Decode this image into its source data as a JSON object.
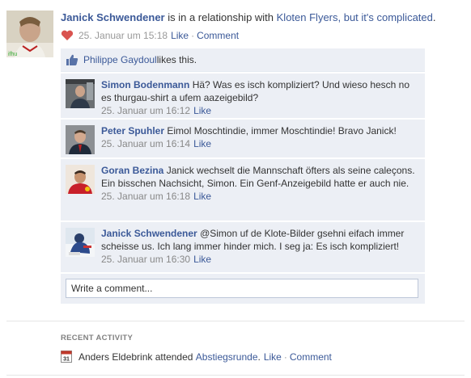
{
  "story": {
    "actor": "Janick Schwendener",
    "text_middle": " is in a relationship with ",
    "target": "Kloten Flyers, but it's complicated",
    "text_end": ".",
    "timestamp": "25. Januar um 15:18",
    "like_label": "Like",
    "comment_label": "Comment"
  },
  "likes": {
    "liker": "Philippe Gaydoul",
    "suffix": " likes this."
  },
  "comments": [
    {
      "author": "Simon Bodenmann",
      "text": "Hä? Was es isch kompliziert? Und wieso hesch no es thurgau-shirt a ufem aazeigebild?",
      "timestamp": "25. Januar um 16:12",
      "like_label": "Like"
    },
    {
      "author": "Peter Spuhler",
      "text": "Eimol Moschtindie, immer Moschtindie! Bravo Janick!",
      "timestamp": "25. Januar um 16:14",
      "like_label": "Like"
    },
    {
      "author": "Goran Bezina",
      "text": "Janick wechselt die Mannschaft öfters als seine caleçons. Ein bisschen Nachsicht, Simon. Ein Genf-Anzeigebild hatte er auch nie.",
      "timestamp": "25. Januar um 16:18",
      "like_label": "Like"
    },
    {
      "author": "Janick Schwendener",
      "text": "@Simon uf de Klote-Bilder gsehni eifach immer scheisse us. Ich lang immer hinder mich. I seg ja: Es isch kompliziert!",
      "timestamp": "25. Januar um 16:30",
      "like_label": "Like"
    }
  ],
  "write_comment": {
    "placeholder": "Write a comment..."
  },
  "recent_activity": {
    "title": "RECENT ACTIVITY",
    "calendar_day": "31",
    "actor": "Anders Eldebrink",
    "verb": " attended ",
    "event": "Abstiegsrunde",
    "after_event": ".",
    "like_label": "Like",
    "comment_label": "Comment"
  },
  "colors": {
    "link": "#3b5998",
    "comment_bg": "#eceff5",
    "heart": "#d9534f"
  }
}
